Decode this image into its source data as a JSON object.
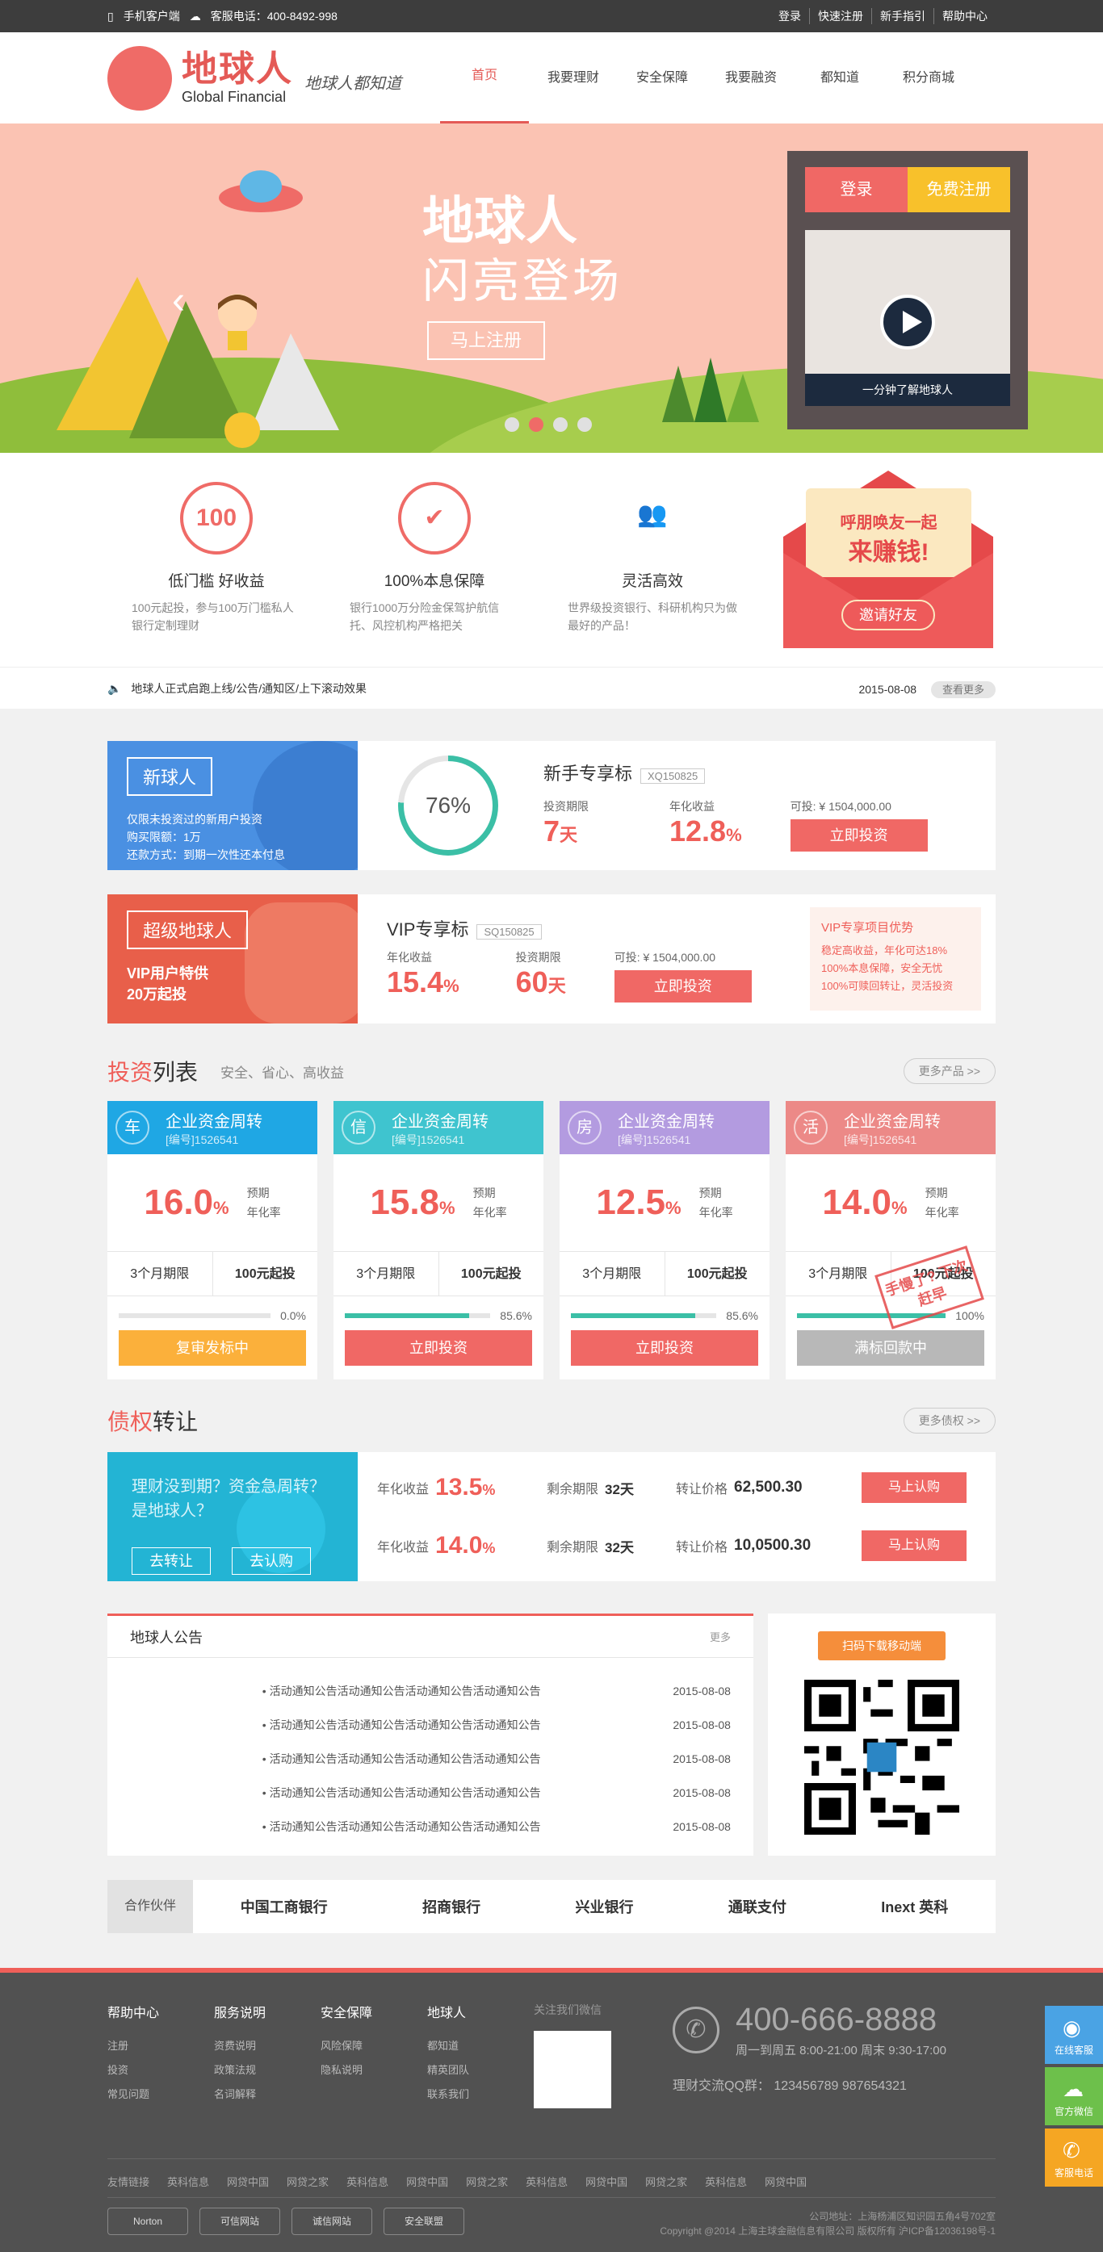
{
  "topbar": {
    "mobile": "手机客户端",
    "service": "客服电话：400-8492-998",
    "links": [
      "登录",
      "快速注册",
      "新手指引",
      "帮助中心"
    ]
  },
  "header": {
    "logo_cn": "地球人",
    "logo_en": "Global Financial",
    "slogan": "地球人都知道",
    "nav": [
      "首页",
      "我要理财",
      "安全保障",
      "我要融资",
      "都知道",
      "积分商城"
    ]
  },
  "banner": {
    "title": "地球人",
    "subtitle": "闪亮登场",
    "cta": "马上注册",
    "login": "登录",
    "register": "免费注册",
    "video_caption": "一分钟了解地球人"
  },
  "features": [
    {
      "icon_text": "100",
      "title": "低门槛 好收益",
      "desc": "100元起投，参与100万门槛私人银行定制理财"
    },
    {
      "icon_text": "✔",
      "title": "100%本息保障",
      "desc": "银行1000万分险金保驾护航信托、风控机构严格把关"
    },
    {
      "icon_text": "👥",
      "title": "灵活高效",
      "desc": "世界级投资银行、科研机构只为做最好的产品！"
    }
  ],
  "invite": {
    "line1": "呼朋唤友一起",
    "line2": "来赚钱!",
    "button": "邀请好友"
  },
  "notice": {
    "text": "地球人正式启跑上线/公告/通知区/上下滚动效果",
    "date": "2015-08-08",
    "more": "查看更多"
  },
  "newbie": {
    "tag": "新球人",
    "bullets": [
      "仅限未投资过的新用户投资",
      "购买限额：1万",
      "还款方式：到期一次性还本付息"
    ],
    "progress": "76%",
    "title": "新手专享标",
    "code": "XQ150825",
    "period_label": "投资期限",
    "period_value": "7",
    "period_unit": "天",
    "rate_label": "年化收益",
    "rate_value": "12.8",
    "rate_unit": "%",
    "available": "可投: ¥ 1504,000.00",
    "button": "立即投资"
  },
  "vip": {
    "tag": "超级地球人",
    "line1": "VIP用户特供",
    "line2": "20万起投",
    "title": "VIP专享标",
    "code": "SQ150825",
    "rate_label": "年化收益",
    "rate_value": "15.4",
    "rate_unit": "%",
    "period_label": "投资期限",
    "period_value": "60",
    "period_unit": "天",
    "available": "可投: ¥ 1504,000.00",
    "button": "立即投资",
    "adv_title": "VIP专享项目优势",
    "adv": [
      "稳定高收益，年化可达18%",
      "100%本息保障，安全无忧",
      "100%可赎回转让，灵活投资"
    ]
  },
  "invest": {
    "title_a": "投资",
    "title_b": "列表",
    "sub": "安全、省心、高收益",
    "more": "更多产品 >>",
    "cards": [
      {
        "badge": "车",
        "name": "企业资金周转",
        "code": "[编号]1526541",
        "rate": "16.0",
        "unit": "%",
        "l1": "预期",
        "l2": "年化率",
        "term": "3个月期限",
        "min": "100元起投",
        "pct": "0.0%",
        "btn": "复审发标中",
        "color": "#1fa7e4",
        "btncolor": "#fbb03b",
        "fill": 0
      },
      {
        "badge": "信",
        "name": "企业资金周转",
        "code": "[编号]1526541",
        "rate": "15.8",
        "unit": "%",
        "l1": "预期",
        "l2": "年化率",
        "term": "3个月期限",
        "min": "100元起投",
        "pct": "85.6%",
        "btn": "立即投资",
        "color": "#3fc4cf",
        "btncolor": "#f06865",
        "fill": 85.6
      },
      {
        "badge": "房",
        "name": "企业资金周转",
        "code": "[编号]1526541",
        "rate": "12.5",
        "unit": "%",
        "l1": "预期",
        "l2": "年化率",
        "term": "3个月期限",
        "min": "100元起投",
        "pct": "85.6%",
        "btn": "立即投资",
        "color": "#b39be0",
        "btncolor": "#f06865",
        "fill": 85.6
      },
      {
        "badge": "活",
        "name": "企业资金周转",
        "code": "[编号]1526541",
        "rate": "14.0",
        "unit": "%",
        "l1": "预期",
        "l2": "年化率",
        "term": "3个月期限",
        "min": "100元起投",
        "pct": "100%",
        "btn": "满标回款中",
        "color": "#ec8987",
        "btncolor": "#b8b8b8",
        "fill": 100,
        "stamp": "手慢了? 下次赶早"
      }
    ]
  },
  "transfer": {
    "title_a": "债权",
    "title_b": "转让",
    "more": "更多债权 >>",
    "ask": "理财没到期？资金急周转？是地球人？",
    "btn_sell": "去转让",
    "btn_buy": "去认购",
    "rows": [
      {
        "rate_label": "年化收益",
        "rate": "13.5",
        "unit": "%",
        "days_label": "剩余期限",
        "days": "32天",
        "price_label": "转让价格",
        "price": "62,500.30",
        "btn": "马上认购"
      },
      {
        "rate_label": "年化收益",
        "rate": "14.0",
        "unit": "%",
        "days_label": "剩余期限",
        "days": "32天",
        "price_label": "转让价格",
        "price": "10,0500.30",
        "btn": "马上认购"
      }
    ]
  },
  "announce": {
    "title": "地球人公告",
    "more": "更多",
    "items": [
      {
        "text": "活动通知公告活动通知公告活动通知公告活动通知公告",
        "date": "2015-08-08"
      },
      {
        "text": "活动通知公告活动通知公告活动通知公告活动通知公告",
        "date": "2015-08-08"
      },
      {
        "text": "活动通知公告活动通知公告活动通知公告活动通知公告",
        "date": "2015-08-08"
      },
      {
        "text": "活动通知公告活动通知公告活动通知公告活动通知公告",
        "date": "2015-08-08"
      },
      {
        "text": "活动通知公告活动通知公告活动通知公告活动通知公告",
        "date": "2015-08-08"
      }
    ],
    "qr_tag": "扫码下载移动端"
  },
  "partners": {
    "label": "合作伙伴",
    "logos": [
      "中国工商银行",
      "招商银行",
      "兴业银行",
      "通联支付",
      "Inext 英科"
    ]
  },
  "footer": {
    "cols": [
      {
        "title": "帮助中心",
        "links": [
          "注册",
          "投资",
          "常见问题"
        ]
      },
      {
        "title": "服务说明",
        "links": [
          "资费说明",
          "政策法规",
          "名词解释"
        ]
      },
      {
        "title": "安全保障",
        "links": [
          "风险保障",
          "隐私说明"
        ]
      },
      {
        "title": "地球人",
        "links": [
          "都知道",
          "精英团队",
          "联系我们"
        ]
      }
    ],
    "wechat": "关注我们微信",
    "phone": "400-666-8888",
    "hours": "周一到周五  8:00-21:00  周末 9:30-17:00",
    "qq": "理财交流QQ群：  123456789    987654321",
    "links": [
      "友情链接",
      "英科信息",
      "网贷中国",
      "网贷之家",
      "英科信息",
      "网贷中国",
      "网贷之家",
      "英科信息",
      "网贷中国",
      "网贷之家",
      "英科信息",
      "网贷中国"
    ],
    "badges": [
      "Norton",
      "可信网站",
      "诚信网站",
      "安全联盟"
    ],
    "addr": "公司地址：上海杨浦区知识园五角4号702室",
    "copy": "Copyright @2014 上海主球金融信息有限公司 版权所有  沪ICP备12036198号-1"
  },
  "side": [
    "在线客服",
    "官方微信",
    "客服电话"
  ]
}
